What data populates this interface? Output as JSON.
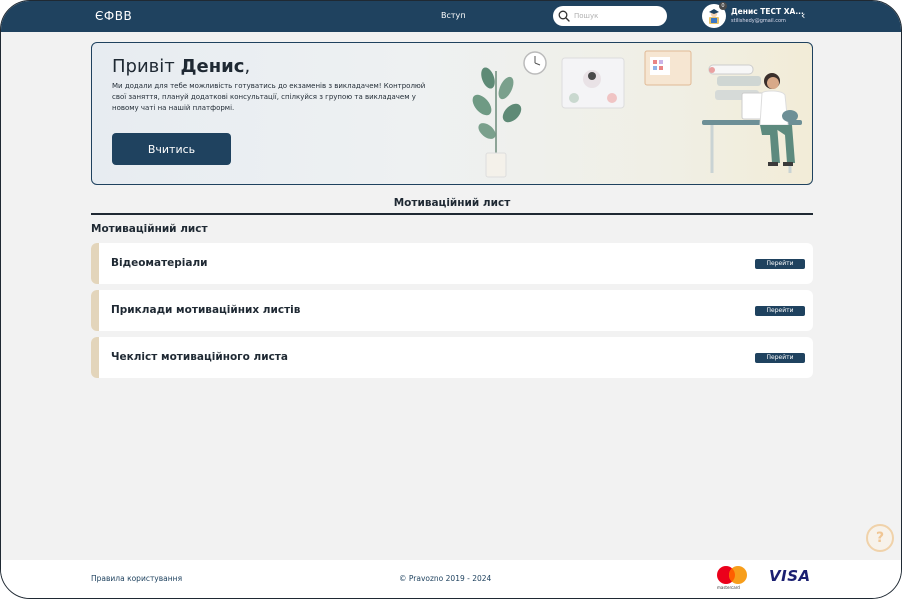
{
  "header": {
    "logo": "ЄФВВ",
    "nav_vstup": "Вступ",
    "search_placeholder": "Пошук",
    "avatar_badge": "0",
    "user_name": "Денис ТЕСТ ХА...",
    "user_email": "stilishedy@gmail.com"
  },
  "banner": {
    "greeting": "Привіт ",
    "name": "Денис",
    "comma": ",",
    "text": "Ми додали для тебе можливість готуватись до екзаменів з викладачем! Контролюй свої заняття, плануй додаткові консультації, спілкуйся з групою та викладачем у новому чаті на нашій платформі.",
    "button": "Вчитись"
  },
  "section": {
    "title": "Мотиваційний лист",
    "subtitle": "Мотиваційний лист"
  },
  "cards": [
    {
      "label": "Відеоматеріали",
      "button": "Перейти"
    },
    {
      "label": "Приклади мотиваційних листів",
      "button": "Перейти"
    },
    {
      "label": "Чекліст мотиваційного листа",
      "button": "Перейти"
    }
  ],
  "help": "?",
  "footer": {
    "terms": "Правила користування",
    "copyright": "© Pravozno 2019 - 2024",
    "mastercard": "mastercard",
    "visa": "VISA"
  },
  "colors": {
    "primary": "#1f425f",
    "card_accent": "#e3d5bb",
    "background": "#f2f2f2"
  }
}
